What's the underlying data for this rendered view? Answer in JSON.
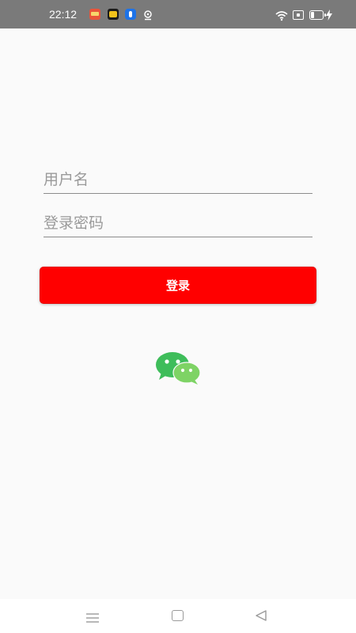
{
  "status_bar": {
    "time": "22:12",
    "icons": [
      "app-notification-icon",
      "app-notification-icon",
      "app-notification-icon",
      "location-icon",
      "wifi-icon",
      "nfc-icon",
      "battery-icon",
      "charging-icon"
    ]
  },
  "login_form": {
    "username_placeholder": "用户名",
    "password_placeholder": "登录密码",
    "login_label": "登录"
  },
  "social_login": {
    "icon": "wechat-icon"
  },
  "nav_bar": {
    "icons": [
      "menu-icon",
      "home-icon",
      "back-icon"
    ]
  },
  "colors": {
    "accent": "#ff0000",
    "status_bar_bg": "#7a7a7a",
    "page_bg": "#fafafa",
    "wechat_green_dark": "#3ebd5a",
    "wechat_green_light": "#7ed365"
  }
}
